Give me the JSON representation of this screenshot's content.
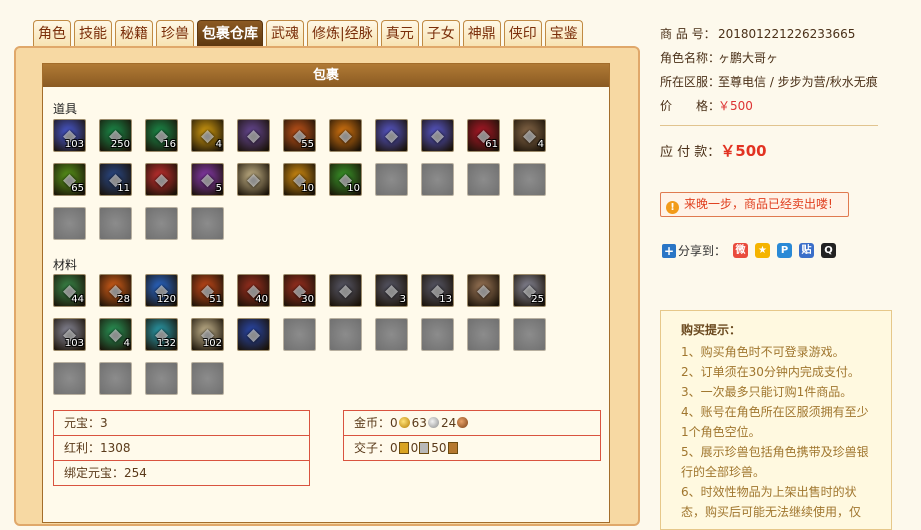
{
  "tabs": [
    {
      "label": "角色",
      "active": false
    },
    {
      "label": "技能",
      "active": false
    },
    {
      "label": "秘籍",
      "active": false
    },
    {
      "label": "珍兽",
      "active": false
    },
    {
      "label": "包裹仓库",
      "active": true
    },
    {
      "label": "武魂",
      "active": false
    },
    {
      "label": "修炼|经脉",
      "active": false
    },
    {
      "label": "真元",
      "active": false
    },
    {
      "label": "子女",
      "active": false
    },
    {
      "label": "神鼎",
      "active": false
    },
    {
      "label": "侠印",
      "active": false
    },
    {
      "label": "宝鉴",
      "active": false
    }
  ],
  "bag": {
    "title": "包裹",
    "props_label": "道具",
    "materials_label": "材料",
    "props": [
      {
        "icon": "gem-cluster-icon",
        "qty": "103",
        "color": "#4a5bd6"
      },
      {
        "icon": "green-orb-icon",
        "qty": "250",
        "color": "#1b8f4c"
      },
      {
        "icon": "green-orb-icon",
        "qty": "16",
        "color": "#1b8f4c"
      },
      {
        "icon": "scroll-card-icon",
        "qty": "4",
        "color": "#d8a010"
      },
      {
        "icon": "gourd-icon",
        "qty": "",
        "color": "#6a4a9a"
      },
      {
        "icon": "fire-sword-icon",
        "qty": "55",
        "color": "#c8561a"
      },
      {
        "icon": "flame-crest-icon",
        "qty": "",
        "color": "#e07a10"
      },
      {
        "icon": "crystal-row-icon",
        "qty": "",
        "color": "#5a5ad0"
      },
      {
        "icon": "crystal-row-icon",
        "qty": "",
        "color": "#5a5ad0"
      },
      {
        "icon": "rose-icon",
        "qty": "61",
        "color": "#b01828"
      },
      {
        "icon": "mooncake-icon",
        "qty": "4",
        "color": "#8a6a4a"
      },
      {
        "icon": "leaf-orb-icon",
        "qty": "65",
        "color": "#5a9a1a"
      },
      {
        "icon": "blue-potion-icon",
        "qty": "11",
        "color": "#2a4a8a"
      },
      {
        "icon": "jade-ring-icon",
        "qty": "",
        "color": "#c83030"
      },
      {
        "icon": "rainbow-orb-icon",
        "qty": "5",
        "color": "#8a3ab0"
      },
      {
        "icon": "paper-map-icon",
        "qty": "",
        "color": "#c9b78a"
      },
      {
        "icon": "gold-coin-icon",
        "qty": "10",
        "color": "#d89010"
      },
      {
        "icon": "green-swirl-icon",
        "qty": "10",
        "color": "#3a9a2a"
      },
      {
        "icon": "empty",
        "qty": "",
        "color": ""
      },
      {
        "icon": "empty",
        "qty": "",
        "color": ""
      },
      {
        "icon": "empty",
        "qty": "",
        "color": ""
      },
      {
        "icon": "empty",
        "qty": "",
        "color": ""
      },
      {
        "icon": "empty",
        "qty": "",
        "color": ""
      },
      {
        "icon": "empty",
        "qty": "",
        "color": ""
      },
      {
        "icon": "empty",
        "qty": "",
        "color": ""
      },
      {
        "icon": "empty",
        "qty": "",
        "color": ""
      }
    ],
    "materials": [
      {
        "icon": "green-jade-icon",
        "qty": "44",
        "color": "#3a8a4a"
      },
      {
        "icon": "fire-burst-icon",
        "qty": "28",
        "color": "#d8601a"
      },
      {
        "icon": "ice-crystal-icon",
        "qty": "120",
        "color": "#2a6ad0"
      },
      {
        "icon": "fruit-icon",
        "qty": "51",
        "color": "#c84a1a"
      },
      {
        "icon": "red-talisman-icon",
        "qty": "40",
        "color": "#a03020"
      },
      {
        "icon": "red-talisman-icon",
        "qty": "30",
        "color": "#a03020"
      },
      {
        "icon": "ore-icon",
        "qty": "",
        "color": "#5a5a6a"
      },
      {
        "icon": "ore-icon",
        "qty": "3",
        "color": "#5a5a6a"
      },
      {
        "icon": "ore-icon",
        "qty": "13",
        "color": "#5a5a6a"
      },
      {
        "icon": "chest-icon",
        "qty": "",
        "color": "#a07a5a"
      },
      {
        "icon": "silver-ore-icon",
        "qty": "25",
        "color": "#8a8a9a"
      },
      {
        "icon": "silver-ore-icon",
        "qty": "103",
        "color": "#8a8a9a"
      },
      {
        "icon": "jade-disc-icon",
        "qty": "4",
        "color": "#2a9a5a"
      },
      {
        "icon": "cyan-blade-icon",
        "qty": "132",
        "color": "#2aa0b0"
      },
      {
        "icon": "parchment-icon",
        "qty": "102",
        "color": "#c8b890"
      },
      {
        "icon": "blue-shard-icon",
        "qty": "",
        "color": "#2a4ab0"
      },
      {
        "icon": "empty",
        "qty": "",
        "color": ""
      },
      {
        "icon": "empty",
        "qty": "",
        "color": ""
      },
      {
        "icon": "empty",
        "qty": "",
        "color": ""
      },
      {
        "icon": "empty",
        "qty": "",
        "color": ""
      },
      {
        "icon": "empty",
        "qty": "",
        "color": ""
      },
      {
        "icon": "empty",
        "qty": "",
        "color": ""
      },
      {
        "icon": "empty",
        "qty": "",
        "color": ""
      },
      {
        "icon": "empty",
        "qty": "",
        "color": ""
      },
      {
        "icon": "empty",
        "qty": "",
        "color": ""
      },
      {
        "icon": "empty",
        "qty": "",
        "color": ""
      }
    ]
  },
  "currency": {
    "yuanbao_label": "元宝：",
    "yuanbao": "3",
    "hongli_label": "红利：",
    "hongli": "1308",
    "bind_label": "绑定元宝：",
    "bind": "254",
    "gold_label": "金币：",
    "gold": "0",
    "silver": "63",
    "copper": "24",
    "jiaozi_label": "交子：",
    "jiaozi_gold": "0",
    "jiaozi_silver": "0",
    "jiaozi_copper": "50"
  },
  "info": {
    "product_no_label": "商 品 号：",
    "product_no": "201801221226233665",
    "role_label": "角色名称：",
    "role": "ヶ鹏大哥ヶ",
    "server_label": "所在区服：",
    "server": "至尊电信 / 步步为营/秋水无痕",
    "price_label": "价　　格：",
    "price": "￥500",
    "pay_label": "应 付 款：",
    "pay": "￥500",
    "sold_msg": "来晚一步，商品已经卖出喽!",
    "share_label": "分享到：",
    "share_icons": [
      "weibo-icon",
      "qzone-icon",
      "pengyou-icon",
      "tieba-icon",
      "qq-icon"
    ]
  },
  "tips": {
    "title": "购买提示：",
    "lines": [
      "1、购买角色时不可登录游戏。",
      "2、订单须在30分钟内完成支付。",
      "3、一次最多只能订购1件商品。",
      "4、账号在角色所在区服须拥有至少",
      "1个角色空位。",
      "5、展示珍兽包括角色携带及珍兽银",
      "行的全部珍兽。",
      "6、时效性物品为上架出售时的状",
      "态，购买后可能无法继续使用，仅"
    ]
  }
}
